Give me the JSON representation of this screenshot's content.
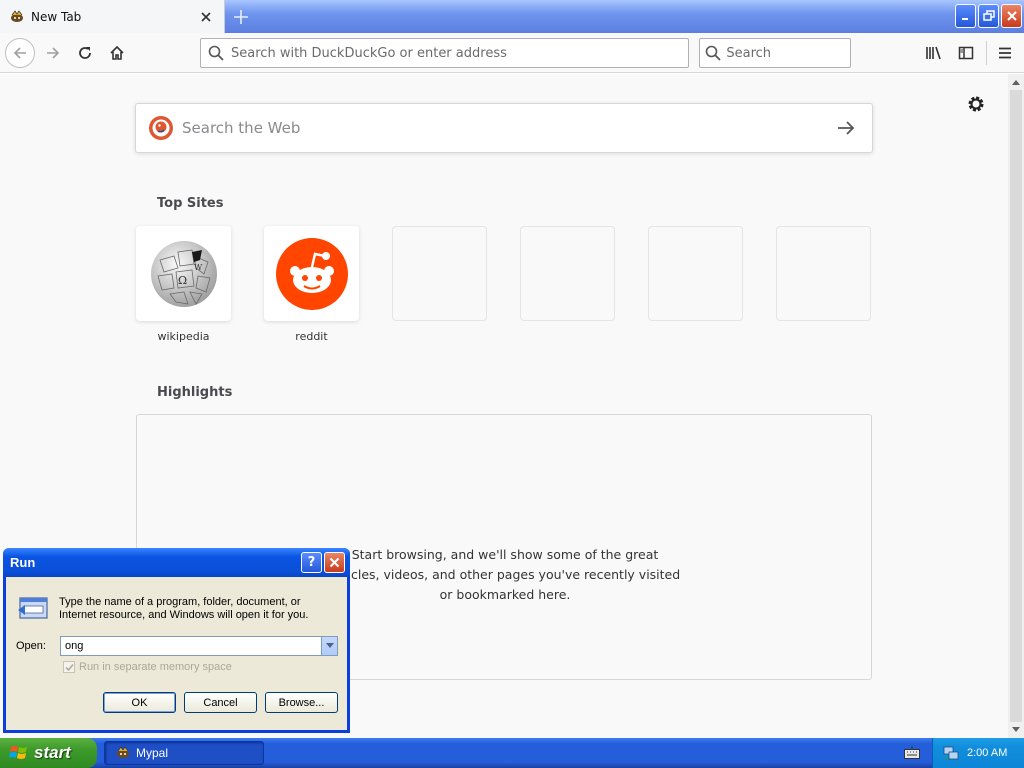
{
  "browser": {
    "tab": {
      "title": "New Tab"
    },
    "urlbar": {
      "placeholder": "Search with DuckDuckGo or enter address"
    },
    "searchbar": {
      "placeholder": "Search"
    }
  },
  "newtab": {
    "websearch": {
      "placeholder": "Search the Web"
    },
    "top_sites": {
      "title": "Top Sites",
      "items": [
        {
          "label": "wikipedia",
          "icon": "wikipedia-icon"
        },
        {
          "label": "reddit",
          "icon": "reddit-icon"
        },
        {
          "label": ""
        },
        {
          "label": ""
        },
        {
          "label": ""
        },
        {
          "label": ""
        }
      ]
    },
    "highlights": {
      "title": "Highlights",
      "message": "Start browsing, and we'll show some of the great articles, videos, and other pages you've recently visited or bookmarked here."
    }
  },
  "run_dialog": {
    "title": "Run",
    "help_label": "?",
    "description": "Type the name of a program, folder, document, or Internet resource, and Windows will open it for you.",
    "open_label": "Open:",
    "open_value": "ong",
    "separate_memory_label": "Run in separate memory space",
    "separate_memory_checked": true,
    "ok_label": "OK",
    "cancel_label": "Cancel",
    "browse_label": "Browse..."
  },
  "taskbar": {
    "start_label": "start",
    "tasks": [
      {
        "label": "Mypal"
      }
    ],
    "clock": "2:00 AM"
  },
  "colors": {
    "xp_blue": "#245edb",
    "start_green": "#3c9a2a",
    "reddit_orange": "#ff4500",
    "ddg_orange": "#de5833"
  }
}
